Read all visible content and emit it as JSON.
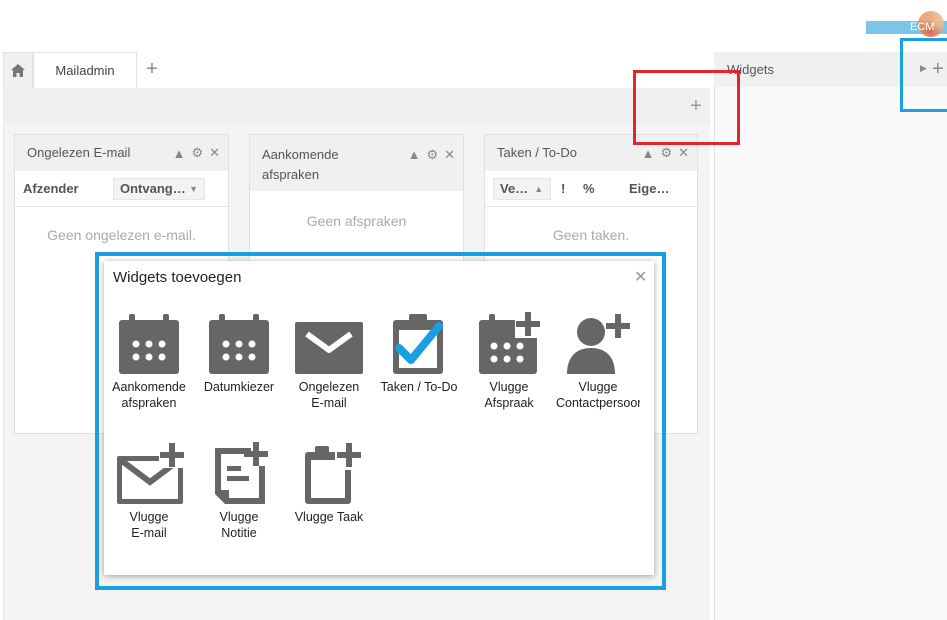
{
  "logo": {
    "text": "ECM"
  },
  "tabs": {
    "active_label": "Mailadmin"
  },
  "sidebar": {
    "title": "Widgets"
  },
  "widgets": [
    {
      "title": "Ongelezen E-mail",
      "columns": [
        "Afzender",
        "Ontvang…"
      ],
      "empty_text": "Geen ongelezen e-mail."
    },
    {
      "title": "Aankomende afspraken",
      "empty_text": "Geen afspraken"
    },
    {
      "title": "Taken / To-Do",
      "columns": [
        "Ve…",
        "!",
        "%",
        "Eige…"
      ],
      "empty_text": "Geen taken."
    }
  ],
  "dialog": {
    "title": "Widgets toevoegen",
    "items": [
      {
        "label": "Aankomende\nafspraken",
        "icon": "calendar-icon"
      },
      {
        "label": "Datumkiezer",
        "icon": "calendar-icon"
      },
      {
        "label": "Ongelezen\nE-mail",
        "icon": "envelope-icon"
      },
      {
        "label": "Taken / To-Do",
        "icon": "clipboard-check-icon"
      },
      {
        "label": "Vlugge\nAfspraak",
        "icon": "calendar-plus-icon"
      },
      {
        "label": "Vlugge\nContactpersoon",
        "icon": "contact-plus-icon"
      },
      {
        "label": "Vlugge\nE-mail",
        "icon": "envelope-plus-icon"
      },
      {
        "label": "Vlugge\nNotitie",
        "icon": "note-plus-icon"
      },
      {
        "label": "Vlugge Taak",
        "icon": "clipboard-plus-icon"
      }
    ]
  },
  "colors": {
    "accent_blue": "#1a9fe2",
    "highlight_red": "#e2262c",
    "icon_gray": "#666666",
    "check_blue": "#1a9fe2"
  }
}
